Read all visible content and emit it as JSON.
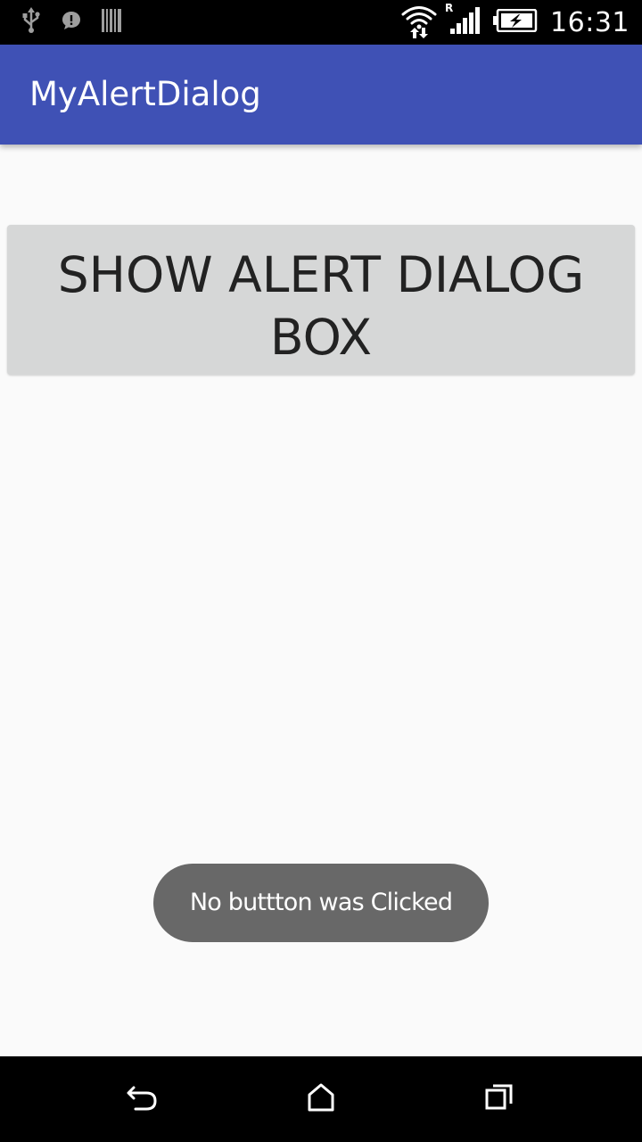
{
  "status_bar": {
    "time": "16:31",
    "icons": [
      "usb-icon",
      "notification-icon",
      "barcode-icon",
      "wifi-icon",
      "signal-icon",
      "battery-charging-icon"
    ],
    "roaming_indicator": "R"
  },
  "app_bar": {
    "title": "MyAlertDialog",
    "color": "#3f51b5"
  },
  "main": {
    "show_dialog_button": "SHOW ALERT DIALOG BOX"
  },
  "toast": {
    "message": "No buttton was Clicked"
  },
  "nav_bar": {
    "icons": [
      "back-icon",
      "home-icon",
      "recents-icon"
    ]
  }
}
